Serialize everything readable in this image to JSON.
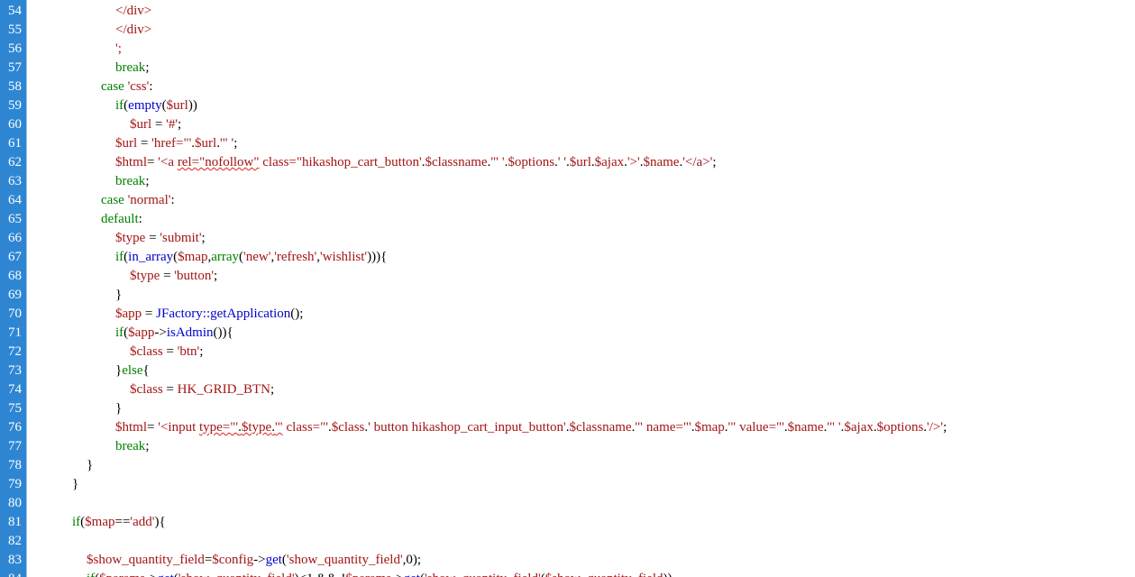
{
  "colors": {
    "gutter_bg": "#2e86d3",
    "line_number": "#ffffff",
    "keyword": "#008000",
    "string": "#a31515",
    "function": "#0000cc",
    "text": "#000000",
    "spellcheck_underline": "#e02020"
  },
  "lines": [
    {
      "n": "54",
      "indent": 6,
      "tokens": [
        {
          "t": "</div>",
          "c": "r"
        }
      ]
    },
    {
      "n": "55",
      "indent": 6,
      "tokens": [
        {
          "t": "</div>",
          "c": "r"
        }
      ]
    },
    {
      "n": "56",
      "indent": 6,
      "tokens": [
        {
          "t": "';",
          "c": "r"
        }
      ]
    },
    {
      "n": "57",
      "indent": 6,
      "tokens": [
        {
          "t": "break",
          "c": "k"
        },
        {
          "t": ";",
          "c": ""
        }
      ]
    },
    {
      "n": "58",
      "indent": 5,
      "tokens": [
        {
          "t": "case ",
          "c": "k"
        },
        {
          "t": "'css'",
          "c": "r"
        },
        {
          "t": ":",
          "c": ""
        }
      ]
    },
    {
      "n": "59",
      "indent": 6,
      "tokens": [
        {
          "t": "if",
          "c": "k"
        },
        {
          "t": "(",
          "c": ""
        },
        {
          "t": "empty",
          "c": "f"
        },
        {
          "t": "(",
          "c": ""
        },
        {
          "t": "$url",
          "c": "r"
        },
        {
          "t": "))",
          "c": ""
        }
      ]
    },
    {
      "n": "60",
      "indent": 7,
      "tokens": [
        {
          "t": "$url",
          "c": "r"
        },
        {
          "t": " = ",
          "c": ""
        },
        {
          "t": "'#'",
          "c": "r"
        },
        {
          "t": ";",
          "c": ""
        }
      ]
    },
    {
      "n": "61",
      "indent": 6,
      "tokens": [
        {
          "t": "$url",
          "c": "r"
        },
        {
          "t": " = ",
          "c": ""
        },
        {
          "t": "'href=\"'",
          "c": "r"
        },
        {
          "t": ".",
          "c": ""
        },
        {
          "t": "$url",
          "c": "r"
        },
        {
          "t": ".",
          "c": ""
        },
        {
          "t": "'\" '",
          "c": "r"
        },
        {
          "t": ";",
          "c": ""
        }
      ]
    },
    {
      "n": "62",
      "indent": 6,
      "tokens": [
        {
          "t": "$html",
          "c": "r"
        },
        {
          "t": "= ",
          "c": ""
        },
        {
          "t": "'<a ",
          "c": "r"
        },
        {
          "t": "rel=\"nofollow\"",
          "c": "r",
          "u": true
        },
        {
          "t": " class=\"hikashop_cart_button'",
          "c": "r"
        },
        {
          "t": ".",
          "c": ""
        },
        {
          "t": "$classname",
          "c": "r"
        },
        {
          "t": ".",
          "c": ""
        },
        {
          "t": "'\" '",
          "c": "r"
        },
        {
          "t": ".",
          "c": ""
        },
        {
          "t": "$options",
          "c": "r"
        },
        {
          "t": ".",
          "c": ""
        },
        {
          "t": "' '",
          "c": "r"
        },
        {
          "t": ".",
          "c": ""
        },
        {
          "t": "$url",
          "c": "r"
        },
        {
          "t": ".",
          "c": ""
        },
        {
          "t": "$ajax",
          "c": "r"
        },
        {
          "t": ".",
          "c": ""
        },
        {
          "t": "'>'",
          "c": "r"
        },
        {
          "t": ".",
          "c": ""
        },
        {
          "t": "$name",
          "c": "r"
        },
        {
          "t": ".",
          "c": ""
        },
        {
          "t": "'</a>'",
          "c": "r"
        },
        {
          "t": ";",
          "c": ""
        }
      ]
    },
    {
      "n": "63",
      "indent": 6,
      "tokens": [
        {
          "t": "break",
          "c": "k"
        },
        {
          "t": ";",
          "c": ""
        }
      ]
    },
    {
      "n": "64",
      "indent": 5,
      "tokens": [
        {
          "t": "case ",
          "c": "k"
        },
        {
          "t": "'normal'",
          "c": "r"
        },
        {
          "t": ":",
          "c": ""
        }
      ]
    },
    {
      "n": "65",
      "indent": 5,
      "tokens": [
        {
          "t": "default",
          "c": "k"
        },
        {
          "t": ":",
          "c": ""
        }
      ]
    },
    {
      "n": "66",
      "indent": 6,
      "tokens": [
        {
          "t": "$type",
          "c": "r"
        },
        {
          "t": " = ",
          "c": ""
        },
        {
          "t": "'submit'",
          "c": "r"
        },
        {
          "t": ";",
          "c": ""
        }
      ]
    },
    {
      "n": "67",
      "indent": 6,
      "tokens": [
        {
          "t": "if",
          "c": "k"
        },
        {
          "t": "(",
          "c": ""
        },
        {
          "t": "in_array",
          "c": "f"
        },
        {
          "t": "(",
          "c": ""
        },
        {
          "t": "$map",
          "c": "r"
        },
        {
          "t": ",",
          "c": ""
        },
        {
          "t": "array",
          "c": "k"
        },
        {
          "t": "(",
          "c": ""
        },
        {
          "t": "'new'",
          "c": "r"
        },
        {
          "t": ",",
          "c": ""
        },
        {
          "t": "'refresh'",
          "c": "r"
        },
        {
          "t": ",",
          "c": ""
        },
        {
          "t": "'wishlist'",
          "c": "r"
        },
        {
          "t": "))){",
          "c": ""
        }
      ]
    },
    {
      "n": "68",
      "indent": 7,
      "tokens": [
        {
          "t": "$type",
          "c": "r"
        },
        {
          "t": " = ",
          "c": ""
        },
        {
          "t": "'button'",
          "c": "r"
        },
        {
          "t": ";",
          "c": ""
        }
      ]
    },
    {
      "n": "69",
      "indent": 6,
      "tokens": [
        {
          "t": "}",
          "c": ""
        }
      ]
    },
    {
      "n": "70",
      "indent": 6,
      "tokens": [
        {
          "t": "$app",
          "c": "r"
        },
        {
          "t": " = ",
          "c": ""
        },
        {
          "t": "JFactory::getApplication",
          "c": "f"
        },
        {
          "t": "();",
          "c": ""
        }
      ]
    },
    {
      "n": "71",
      "indent": 6,
      "tokens": [
        {
          "t": "if",
          "c": "k"
        },
        {
          "t": "(",
          "c": ""
        },
        {
          "t": "$app",
          "c": "r"
        },
        {
          "t": "->",
          "c": ""
        },
        {
          "t": "isAdmin",
          "c": "f"
        },
        {
          "t": "()){",
          "c": ""
        }
      ]
    },
    {
      "n": "72",
      "indent": 7,
      "tokens": [
        {
          "t": "$class",
          "c": "r"
        },
        {
          "t": " = ",
          "c": ""
        },
        {
          "t": "'btn'",
          "c": "r"
        },
        {
          "t": ";",
          "c": ""
        }
      ]
    },
    {
      "n": "73",
      "indent": 6,
      "tokens": [
        {
          "t": "}",
          "c": ""
        },
        {
          "t": "else",
          "c": "k"
        },
        {
          "t": "{",
          "c": ""
        }
      ]
    },
    {
      "n": "74",
      "indent": 7,
      "tokens": [
        {
          "t": "$class",
          "c": "r"
        },
        {
          "t": " = ",
          "c": ""
        },
        {
          "t": "HK_GRID_BTN",
          "c": "r"
        },
        {
          "t": ";",
          "c": ""
        }
      ]
    },
    {
      "n": "75",
      "indent": 6,
      "tokens": [
        {
          "t": "}",
          "c": ""
        }
      ]
    },
    {
      "n": "76",
      "indent": 6,
      "tokens": [
        {
          "t": "$html",
          "c": "r"
        },
        {
          "t": "= ",
          "c": ""
        },
        {
          "t": "'<input ",
          "c": "r"
        },
        {
          "t": "type=\"'",
          "c": "r",
          "u": true
        },
        {
          "t": ".",
          "c": "",
          "u": true
        },
        {
          "t": "$type",
          "c": "r",
          "u": true
        },
        {
          "t": ".",
          "c": "",
          "u": true
        },
        {
          "t": "'\"",
          "c": "r",
          "u": true
        },
        {
          "t": " class=\"'",
          "c": "r"
        },
        {
          "t": ".",
          "c": ""
        },
        {
          "t": "$class",
          "c": "r"
        },
        {
          "t": ".",
          "c": ""
        },
        {
          "t": "' button hikashop_cart_input_button'",
          "c": "r"
        },
        {
          "t": ".",
          "c": ""
        },
        {
          "t": "$classname",
          "c": "r"
        },
        {
          "t": ".",
          "c": ""
        },
        {
          "t": "'\" name=\"'",
          "c": "r"
        },
        {
          "t": ".",
          "c": ""
        },
        {
          "t": "$map",
          "c": "r"
        },
        {
          "t": ".",
          "c": ""
        },
        {
          "t": "'\" value=\"'",
          "c": "r"
        },
        {
          "t": ".",
          "c": ""
        },
        {
          "t": "$name",
          "c": "r"
        },
        {
          "t": ".",
          "c": ""
        },
        {
          "t": "'\" '",
          "c": "r"
        },
        {
          "t": ".",
          "c": ""
        },
        {
          "t": "$ajax",
          "c": "r"
        },
        {
          "t": ".",
          "c": ""
        },
        {
          "t": "$options",
          "c": "r"
        },
        {
          "t": ".",
          "c": ""
        },
        {
          "t": "'/>'",
          "c": "r"
        },
        {
          "t": ";",
          "c": ""
        }
      ]
    },
    {
      "n": "77",
      "indent": 6,
      "tokens": [
        {
          "t": "break",
          "c": "k"
        },
        {
          "t": ";",
          "c": ""
        }
      ]
    },
    {
      "n": "78",
      "indent": 4,
      "tokens": [
        {
          "t": "}",
          "c": ""
        }
      ]
    },
    {
      "n": "79",
      "indent": 3,
      "tokens": [
        {
          "t": "}",
          "c": ""
        }
      ]
    },
    {
      "n": "80",
      "indent": 0,
      "tokens": []
    },
    {
      "n": "81",
      "indent": 3,
      "tokens": [
        {
          "t": "if",
          "c": "k"
        },
        {
          "t": "(",
          "c": ""
        },
        {
          "t": "$map",
          "c": "r"
        },
        {
          "t": "==",
          "c": ""
        },
        {
          "t": "'add'",
          "c": "r"
        },
        {
          "t": "){",
          "c": ""
        }
      ]
    },
    {
      "n": "82",
      "indent": 0,
      "tokens": []
    },
    {
      "n": "83",
      "indent": 4,
      "tokens": [
        {
          "t": "$show_quantity_field",
          "c": "r"
        },
        {
          "t": "=",
          "c": ""
        },
        {
          "t": "$config",
          "c": "r"
        },
        {
          "t": "->",
          "c": ""
        },
        {
          "t": "get",
          "c": "f"
        },
        {
          "t": "(",
          "c": ""
        },
        {
          "t": "'show_quantity_field'",
          "c": "r"
        },
        {
          "t": ",0);",
          "c": ""
        }
      ]
    },
    {
      "n": "84",
      "indent": 4,
      "tokens": [
        {
          "t": "if",
          "c": "k"
        },
        {
          "t": "(",
          "c": ""
        },
        {
          "t": "$params",
          "c": "r"
        },
        {
          "t": "->",
          "c": ""
        },
        {
          "t": "get",
          "c": "f"
        },
        {
          "t": "(",
          "c": ""
        },
        {
          "t": "'show_quantity_field'",
          "c": "r"
        },
        {
          "t": ")<1 && !",
          "c": ""
        },
        {
          "t": "$params",
          "c": "r"
        },
        {
          "t": "->",
          "c": ""
        },
        {
          "t": "get",
          "c": "f"
        },
        {
          "t": "(",
          "c": ""
        },
        {
          "t": "'show_quantity_field'",
          "c": "r"
        },
        {
          "t": "(",
          "c": ""
        },
        {
          "t": "$show_quantity_field",
          "c": "r"
        },
        {
          "t": "))",
          "c": ""
        }
      ]
    }
  ]
}
